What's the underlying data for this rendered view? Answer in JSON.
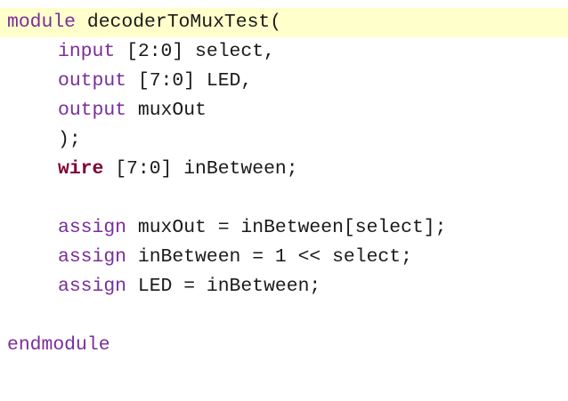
{
  "editor": {
    "language": "verilog",
    "colors": {
      "keyword": "#7a2e9a",
      "declaration_keyword": "#7f0033",
      "text": "#1a1a1a",
      "current_line_highlight": "#ffffcc",
      "background": "#ffffff"
    },
    "lines": [
      {
        "keyword": "module",
        "text": " decoderToMuxTest("
      },
      {
        "keyword": "input",
        "text": " [2:0] select,"
      },
      {
        "keyword": "output",
        "text": " [7:0] LED,"
      },
      {
        "keyword": "output",
        "text": " muxOut"
      },
      {
        "text": ");"
      },
      {
        "keyword": "wire",
        "text": " [7:0] inBetween;"
      },
      {
        "text": ""
      },
      {
        "keyword": "assign",
        "text": " muxOut = inBetween[select];"
      },
      {
        "keyword": "assign",
        "text": " inBetween = 1 << select;"
      },
      {
        "keyword": "assign",
        "text": " LED = inBetween;"
      },
      {
        "text": ""
      },
      {
        "keyword": "endmodule",
        "text": ""
      }
    ]
  }
}
